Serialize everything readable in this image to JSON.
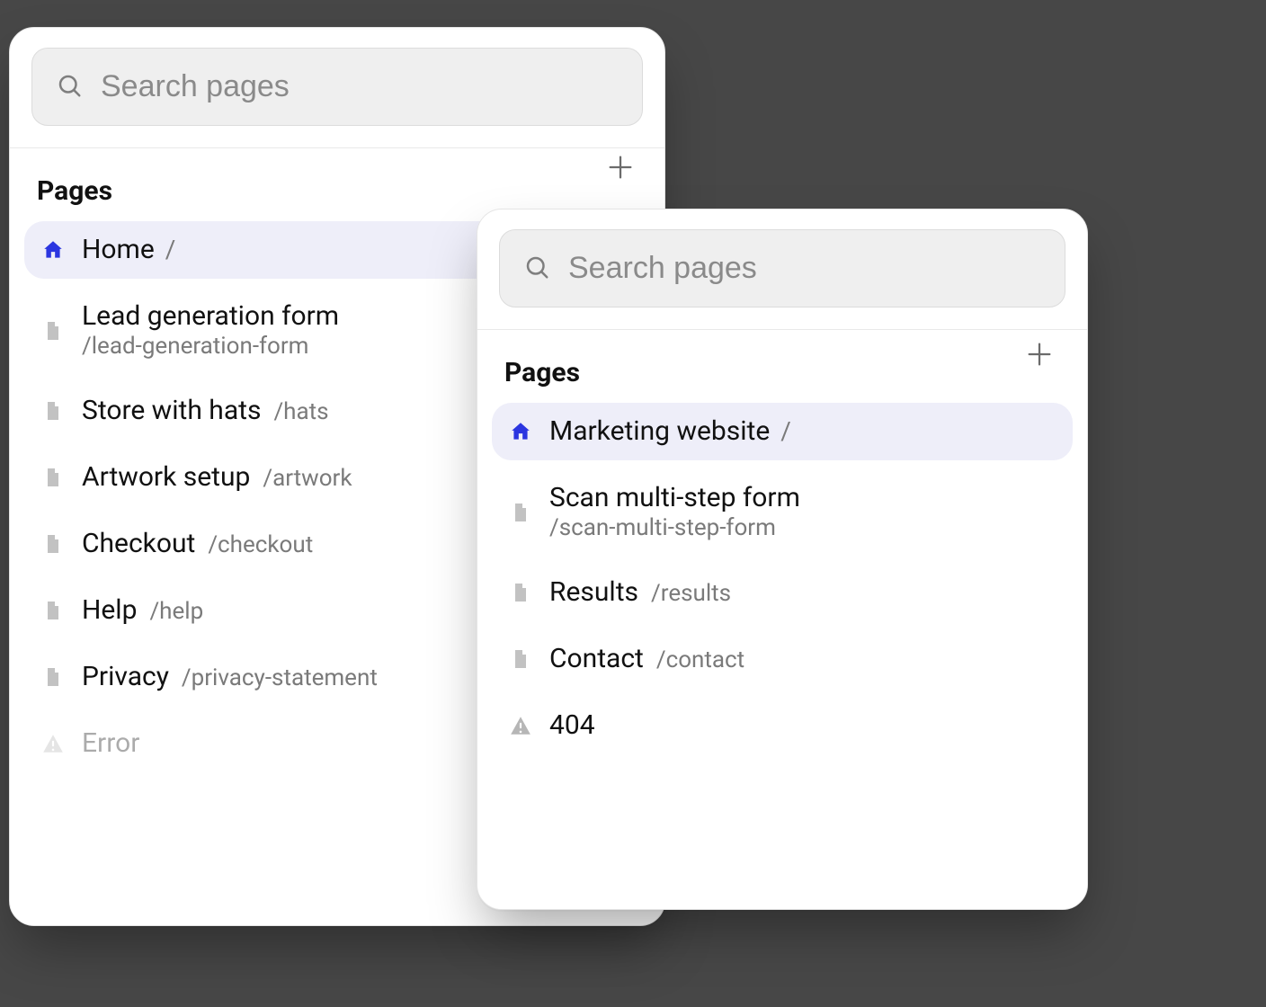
{
  "search": {
    "placeholder": "Search pages"
  },
  "section": {
    "title": "Pages"
  },
  "colors": {
    "accent": "#2b35e0",
    "selected_bg": "#eeeef9",
    "icon_gray": "#bdbdbd"
  },
  "panelA": {
    "items": [
      {
        "icon": "home",
        "title": "Home",
        "path": "/",
        "selected": true,
        "layout": "slash"
      },
      {
        "icon": "page",
        "title": "Lead generation form",
        "path": "/lead-generation-form",
        "selected": false,
        "layout": "stack"
      },
      {
        "icon": "page",
        "title": "Store with hats",
        "path": "/hats",
        "selected": false,
        "layout": "inline"
      },
      {
        "icon": "page",
        "title": "Artwork setup",
        "path": "/artwork",
        "selected": false,
        "layout": "inline"
      },
      {
        "icon": "page",
        "title": "Checkout",
        "path": "/checkout",
        "selected": false,
        "layout": "inline"
      },
      {
        "icon": "page",
        "title": "Help",
        "path": "/help",
        "selected": false,
        "layout": "inline"
      },
      {
        "icon": "page",
        "title": "Privacy",
        "path": "/privacy-statement",
        "selected": false,
        "layout": "inline"
      },
      {
        "icon": "warning",
        "title": "Error",
        "path": "",
        "selected": false,
        "layout": "ghost"
      }
    ]
  },
  "panelB": {
    "items": [
      {
        "icon": "home",
        "title": "Marketing website",
        "path": "/",
        "selected": true,
        "layout": "slash"
      },
      {
        "icon": "page",
        "title": "Scan multi-step form",
        "path": "/scan-multi-step-form",
        "selected": false,
        "layout": "stack"
      },
      {
        "icon": "page",
        "title": "Results",
        "path": "/results",
        "selected": false,
        "layout": "inline"
      },
      {
        "icon": "page",
        "title": "Contact",
        "path": "/contact",
        "selected": false,
        "layout": "inline"
      },
      {
        "icon": "warning",
        "title": "404",
        "path": "",
        "selected": false,
        "layout": "inline"
      }
    ]
  }
}
